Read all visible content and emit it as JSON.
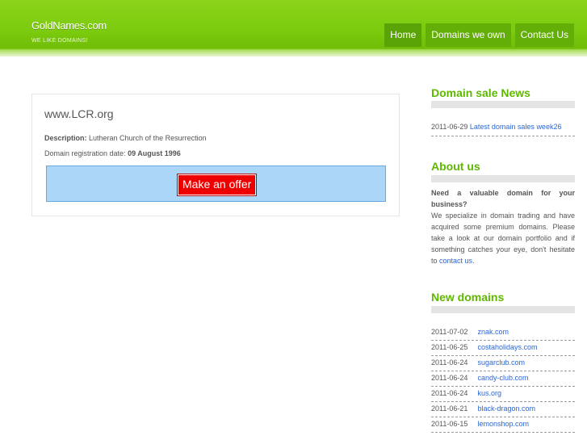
{
  "header": {
    "site_title": "GoldNames.com",
    "tagline": "WE LIKE DOMAINS!",
    "nav": [
      {
        "label": "Home"
      },
      {
        "label": "Domains we own"
      },
      {
        "label": "Contact Us"
      }
    ]
  },
  "domain": {
    "name": "www.LCR.org",
    "description_label": "Description:",
    "description": "Lutheran Church of the Resurrection",
    "registration_label": "Domain registration date:",
    "registration_date": "09 August 1996",
    "offer_button": "Make an offer"
  },
  "sidebar": {
    "news_heading": "Domain sale News",
    "news": [
      {
        "date": "2011-06-29",
        "title": "Latest domain sales week26"
      }
    ],
    "about_heading": "About us",
    "about_bold": "Need a valuable domain for your business?",
    "about_text": "We specialize in domain trading and have acquired some premium domains. Please take a look at our domain portfolio and if something catches your eye, don't hesitate to",
    "about_link": "contact us",
    "about_end": ".",
    "new_domains_heading": "New domains",
    "new_domains": [
      {
        "date": "2011-07-02",
        "domain": "znak.com"
      },
      {
        "date": "2011-06-25",
        "domain": "costaholidays.com"
      },
      {
        "date": "2011-06-24",
        "domain": "sugarclub.com"
      },
      {
        "date": "2011-06-24",
        "domain": "candy-club.com"
      },
      {
        "date": "2011-06-24",
        "domain": "kus.org"
      },
      {
        "date": "2011-06-21",
        "domain": "black-dragon.com"
      },
      {
        "date": "2011-06-15",
        "domain": "lemonshop.com"
      }
    ]
  },
  "colors": {
    "header_green": "#7ccb0e",
    "heading_green": "#5fb800",
    "link_blue": "#2a66d6",
    "offer_red": "#ee0000",
    "offer_panel_blue": "#acd6f8"
  }
}
